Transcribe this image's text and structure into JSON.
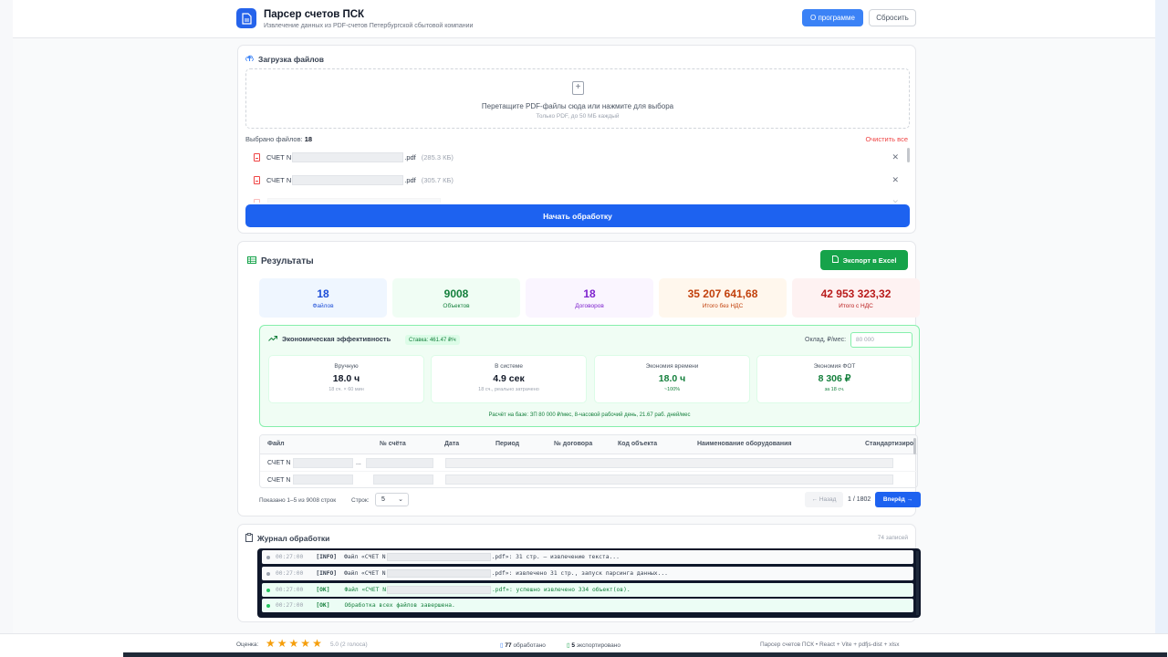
{
  "header": {
    "title": "Парсер счетов ПСК",
    "subtitle": "Извлечение данных из PDF-счетов Петербургской сбытовой компании",
    "about_button": "О программе",
    "reset_button": "Сбросить"
  },
  "upload": {
    "title": "Загрузка файлов",
    "dropzone_main": "Перетащите PDF-файлы сюда или нажмите для выбора",
    "dropzone_sub": "Только PDF, до 50 МБ каждый",
    "selected_label": "Выбрано файлов:",
    "selected_count": "18",
    "clear_all": "Очистить все",
    "files": [
      {
        "prefix": "СЧЕТ N",
        "suffix": ".pdf",
        "size": "(285.3 КБ)"
      },
      {
        "prefix": "СЧЕТ N",
        "suffix": ".pdf",
        "size": "(305.7 КБ)"
      }
    ],
    "start_button": "Начать обработку"
  },
  "results": {
    "title": "Результаты",
    "export_button": "Экспорт в Excel",
    "stats": [
      {
        "value": "18",
        "label": "Файлов",
        "color": "#1d4ed8",
        "bg": "#eff6ff"
      },
      {
        "value": "9008",
        "label": "Объектов",
        "color": "#15803d",
        "bg": "#f0fdf4"
      },
      {
        "value": "18",
        "label": "Договоров",
        "color": "#7e22ce",
        "bg": "#faf5ff"
      },
      {
        "value": "35 207 641,68",
        "label": "Итого без НДС",
        "color": "#c2410c",
        "bg": "#fff7ed"
      },
      {
        "value": "42 953 323,32",
        "label": "Итого с НДС",
        "color": "#b91c1c",
        "bg": "#fef2f2"
      }
    ],
    "economy": {
      "title": "Экономическая эффективность",
      "rate": "Ставка: 461.47 ₽/ч",
      "salary_label": "Оклад, ₽/мес:",
      "salary_value": "80 000",
      "boxes": [
        {
          "title": "Вручную",
          "value": "18.0 ч",
          "sub": "18 сч. × 60 мин"
        },
        {
          "title": "В системе",
          "value": "4.9 сек",
          "sub": "18 сч., реально затрачено"
        },
        {
          "title": "Экономия времени",
          "value": "18.0 ч",
          "sub": "~100%"
        },
        {
          "title": "Экономия ФОТ",
          "value": "8 306 ₽",
          "sub": "за 18 сч."
        }
      ],
      "note": "Расчёт на базе: ЗП 80 000 ₽/мес, 8-часовой рабочий день, 21.67 раб. дней/мес"
    },
    "table": {
      "columns": [
        "Файл",
        "№ счёта",
        "Дата",
        "Период",
        "№ договора",
        "Код объекта",
        "Наименование оборудования",
        "Стандартизиро"
      ],
      "rows": [
        {
          "file": "СЧЕТ N",
          "tail": "..."
        },
        {
          "file": "СЧЕТ N",
          "tail": ""
        }
      ]
    },
    "pager": {
      "info": "Показано 1–5 из 9008 строк",
      "rows_label": "Строк:",
      "rows_value": "5",
      "prev": "← Назад",
      "page": "1 / 1802",
      "next": "Вперёд →"
    }
  },
  "log": {
    "title": "Журнал обработки",
    "count": "74 записей",
    "lines": [
      {
        "time": "00:27:00",
        "tag": "[INFO]",
        "pre": "Файл «СЧЕТ N",
        "post": ".pdf»: 31 стр. — извлечение текста...",
        "kind": "info"
      },
      {
        "time": "00:27:00",
        "tag": "[INFO]",
        "pre": "Файл «СЧЕТ N",
        "post": ".pdf»: извлечено 31 стр., запуск парсинга данных...",
        "kind": "info"
      },
      {
        "time": "00:27:00",
        "tag": "[OK]",
        "pre": "Файл «СЧЕТ N",
        "post": ".pdf»: успешно извлечено 334 объект(ов).",
        "kind": "ok"
      },
      {
        "time": "00:27:00",
        "tag": "[OK]",
        "pre": "Обработка всех файлов завершена.",
        "post": "",
        "kind": "ok"
      }
    ]
  },
  "footer": {
    "rating_label": "Оценка:",
    "stars": 5,
    "rating_value": "5.0 (2 голоса)",
    "processed_count": "77",
    "processed_label": "обработано",
    "exported_count": "5",
    "exported_label": "экспортировано",
    "credit": "Парсер счетов ПСК • React + Vite + pdfjs-dist + xlsx"
  }
}
